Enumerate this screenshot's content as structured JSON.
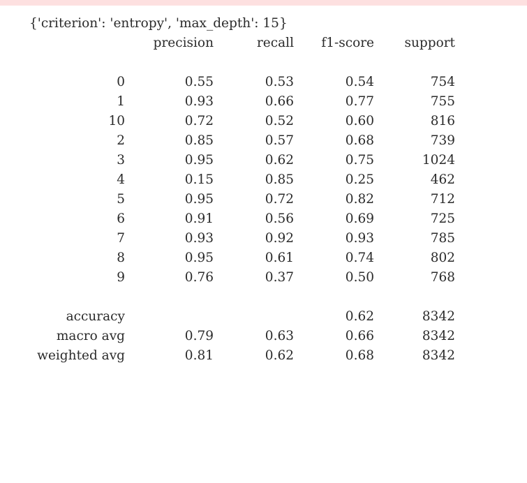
{
  "params_line": "{'criterion': 'entropy', 'max_depth': 15}",
  "headers": [
    "precision",
    "recall",
    "f1-score",
    "support"
  ],
  "rows": [
    {
      "label": "0",
      "precision": "0.55",
      "recall": "0.53",
      "f1": "0.54",
      "support": "754"
    },
    {
      "label": "1",
      "precision": "0.93",
      "recall": "0.66",
      "f1": "0.77",
      "support": "755"
    },
    {
      "label": "10",
      "precision": "0.72",
      "recall": "0.52",
      "f1": "0.60",
      "support": "816"
    },
    {
      "label": "2",
      "precision": "0.85",
      "recall": "0.57",
      "f1": "0.68",
      "support": "739"
    },
    {
      "label": "3",
      "precision": "0.95",
      "recall": "0.62",
      "f1": "0.75",
      "support": "1024"
    },
    {
      "label": "4",
      "precision": "0.15",
      "recall": "0.85",
      "f1": "0.25",
      "support": "462"
    },
    {
      "label": "5",
      "precision": "0.95",
      "recall": "0.72",
      "f1": "0.82",
      "support": "712"
    },
    {
      "label": "6",
      "precision": "0.91",
      "recall": "0.56",
      "f1": "0.69",
      "support": "725"
    },
    {
      "label": "7",
      "precision": "0.93",
      "recall": "0.92",
      "f1": "0.93",
      "support": "785"
    },
    {
      "label": "8",
      "precision": "0.95",
      "recall": "0.61",
      "f1": "0.74",
      "support": "802"
    },
    {
      "label": "9",
      "precision": "0.76",
      "recall": "0.37",
      "f1": "0.50",
      "support": "768"
    }
  ],
  "summary": [
    {
      "label": "accuracy",
      "precision": "",
      "recall": "",
      "f1": "0.62",
      "support": "8342"
    },
    {
      "label": "macro avg",
      "precision": "0.79",
      "recall": "0.63",
      "f1": "0.66",
      "support": "8342"
    },
    {
      "label": "weighted avg",
      "precision": "0.81",
      "recall": "0.62",
      "f1": "0.68",
      "support": "8342"
    }
  ],
  "colors": {
    "text": "#2b2b2b",
    "top_band": "#fde0e0",
    "background": "#ffffff"
  }
}
